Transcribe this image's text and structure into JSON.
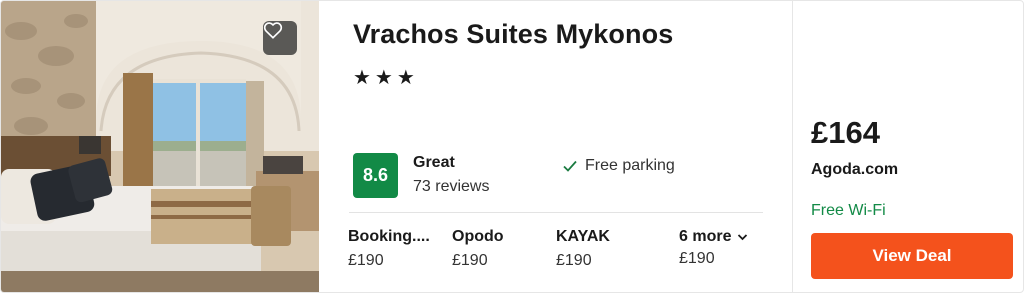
{
  "hotel": {
    "name": "Vrachos Suites Mykonos",
    "stars": "★★★",
    "rating": {
      "score": "8.6",
      "label": "Great",
      "reviews": "73 reviews"
    },
    "amenity": "Free parking"
  },
  "providers": [
    {
      "name": "Booking....",
      "price": "£190"
    },
    {
      "name": "Opodo",
      "price": "£190"
    },
    {
      "name": "KAYAK",
      "price": "£190"
    },
    {
      "name": "6 more",
      "price": "£190"
    }
  ],
  "deal": {
    "price": "£164",
    "provider": "Agoda.com",
    "amenity": "Free Wi-Fi",
    "button_label": "View Deal"
  },
  "icons": {
    "favorite": "heart-icon",
    "check": "check-icon",
    "more": "chevron-down-icon"
  },
  "colors": {
    "rating_badge": "#128a46",
    "deal_amenity": "#128a46",
    "cta": "#f4521c"
  }
}
